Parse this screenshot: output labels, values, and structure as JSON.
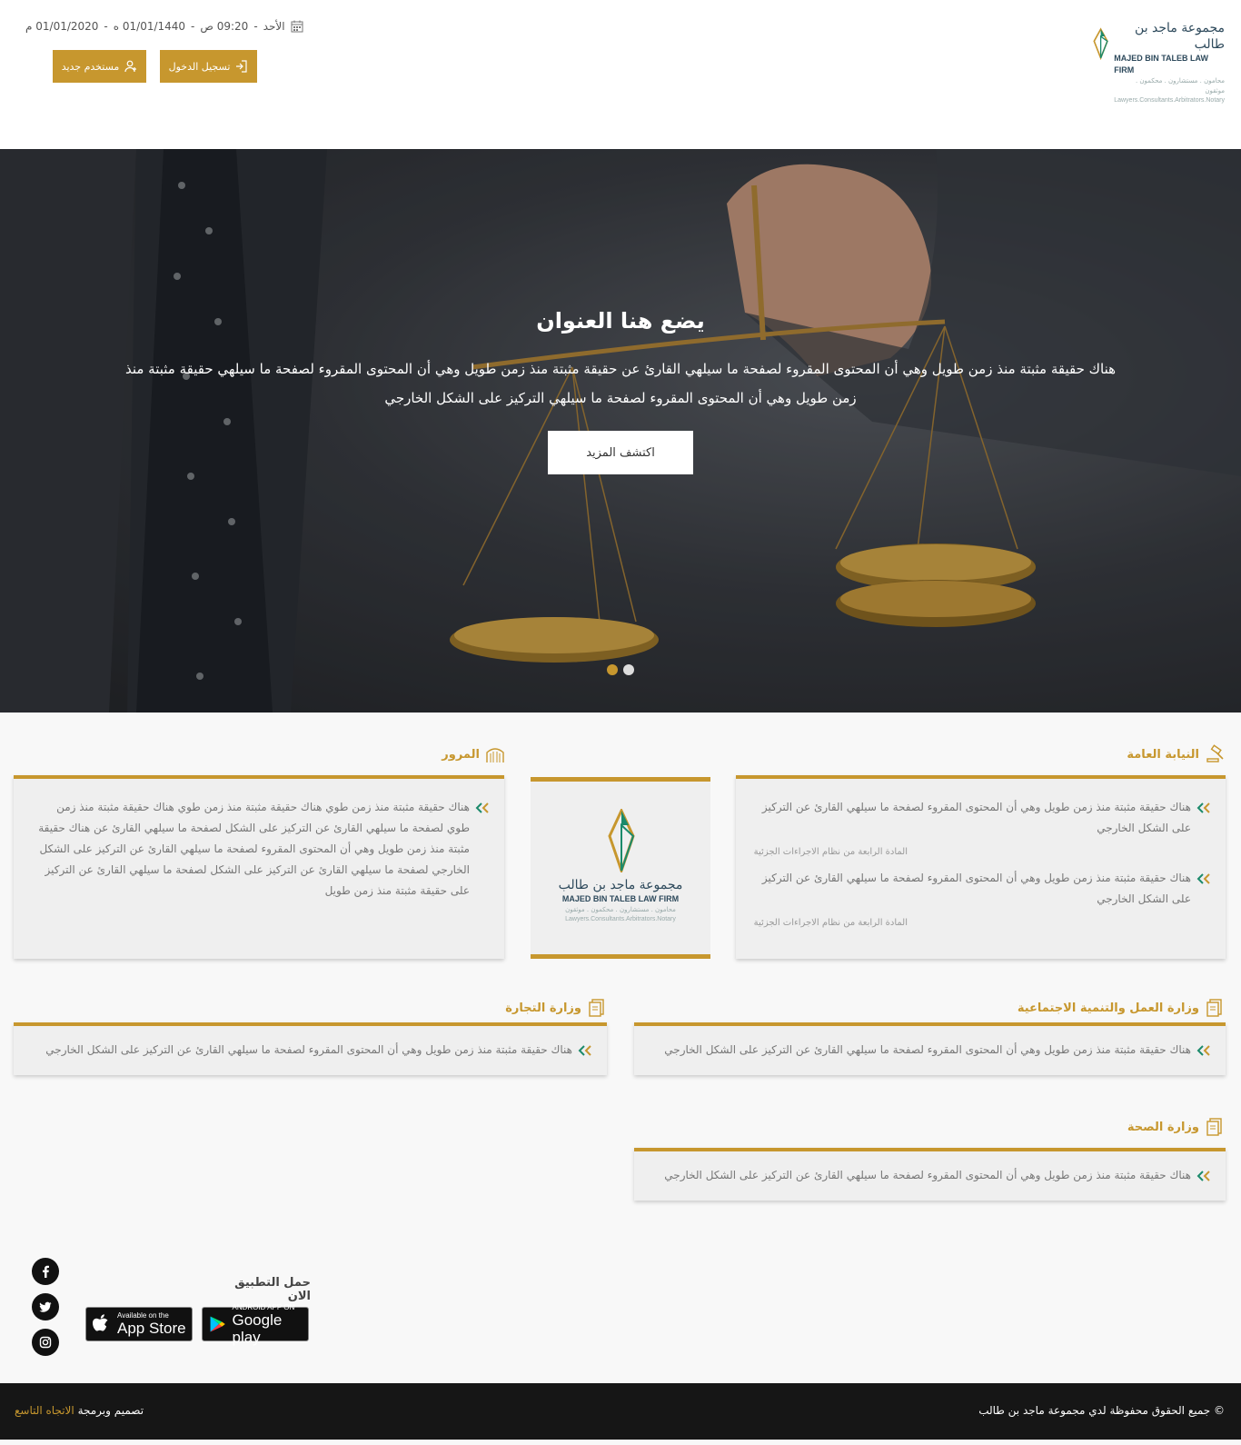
{
  "header": {
    "logo": {
      "name_ar": "مجموعة ماجد بن طالب",
      "name_en": "MAJED BIN TALEB LAW FIRM",
      "tagline_ar": "محامون . مستشارون . محكمون . موثقون",
      "tagline_en": "Lawyers.Consultants.Arbitrators.Notary"
    },
    "date": {
      "day": "الأحد",
      "time": "09:20 ص",
      "hijri": "01/01/1440 ه",
      "gregorian": "01/01/2020 م",
      "sep": "-"
    },
    "login_label": "تسجيل الدخول",
    "register_label": "مستخدم جديد",
    "accent": "#c7972e"
  },
  "hero": {
    "title": "يضع هنا العنوان",
    "text": "هناك حقيقة مثبتة منذ زمن طويل وهي أن المحتوى المقروء لصفحة ما سيلهي القارئ عن حقيقة مثبتة منذ زمن طويل وهي أن المحتوى المقروء لصفحة ما سيلهي حقيقة مثبتة منذ زمن طويل وهي أن المحتوى المقروء لصفحة ما سيلهي التركيز على الشكل الخارجي",
    "button_label": "اكتشف المزيد",
    "slides": 2,
    "active_slide": 1
  },
  "sections": {
    "public_prosecution": {
      "title": "النيابة العامة",
      "icon": "gavel-icon",
      "items": [
        {
          "text": "هناك حقيقة مثبتة منذ زمن طويل وهي أن المحتوى المقروء لصفحة ما سيلهي القارئ عن التركيز على الشكل الخارجي",
          "note": "المادة الرابعة من نظام الاجراءات الجزئية"
        },
        {
          "text": "هناك حقيقة مثبتة منذ زمن طويل وهي أن المحتوى المقروء لصفحة ما سيلهي القارئ عن التركيز على الشكل الخارجي",
          "note": "المادة الرابعة من نظام الاجراءات الجزئية"
        }
      ]
    },
    "traffic": {
      "title": "المرور",
      "icon": "building-icon",
      "items": [
        {
          "text": "هناك حقيقة مثبتة منذ زمن طوي هناك حقيقة مثبتة منذ زمن طوي هناك حقيقة مثبتة منذ زمن طوي لصفحة ما سيلهي القارئ عن التركيز على الشكل لصفحة ما سيلهي القارئ عن هناك حقيقة مثبتة منذ زمن طويل وهي أن المحتوى المقروء لصفحة ما سيلهي القارئ عن التركيز على الشكل الخارجي لصفحة ما سيلهي القارئ عن التركيز على الشكل لصفحة ما سيلهي القارئ عن التركيز على حقيقة مثبتة منذ زمن طويل"
        }
      ]
    },
    "labor": {
      "title": "وزارة العمل والتنمية الاجتماعية",
      "icon": "document-icon",
      "items": [
        {
          "text": "هناك حقيقة مثبتة منذ زمن طويل وهي أن المحتوى المقروء لصفحة ما سيلهي القارئ عن التركيز على الشكل الخارجي"
        }
      ]
    },
    "commerce": {
      "title": "وزارة التجارة",
      "icon": "document-icon",
      "items": [
        {
          "text": "هناك حقيقة مثبتة منذ زمن طويل وهي أن المحتوى المقروء لصفحة ما سيلهي القارئ عن التركيز على الشكل الخارجي"
        }
      ]
    },
    "health": {
      "title": "وزارة الصحة",
      "icon": "document-icon",
      "items": [
        {
          "text": "هناك حقيقة مثبتة منذ زمن طويل وهي أن المحتوى المقروء لصفحة ما سيلهي القارئ عن التركيز على الشكل الخارجي"
        }
      ]
    }
  },
  "app": {
    "title": "حمل التطبيق الان",
    "appstore_small": "Available on the",
    "appstore_big": "App Store",
    "googleplay_small": "ANDROID APP ON",
    "googleplay_big": "Google play"
  },
  "social": [
    "facebook-icon",
    "twitter-icon",
    "instagram-icon"
  ],
  "footer": {
    "copyright": "© جميع الحقوق محفوظة لدي مجموعة ماجد بن طالب",
    "credit_prefix": "تصميم وبرمجة",
    "credit_link": "الاتجاه التاسع"
  }
}
